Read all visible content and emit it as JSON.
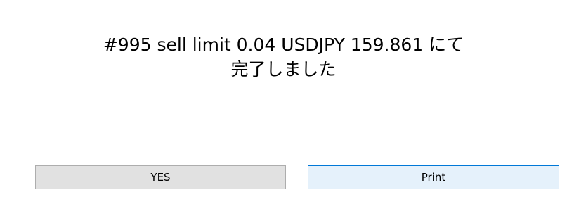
{
  "dialog": {
    "message_line1": "#995 sell limit 0.04 USDJPY 159.861 にて",
    "message_line2": "完了しました"
  },
  "buttons": {
    "yes_label": "YES",
    "print_label": "Print"
  },
  "colors": {
    "background": "#ffffff",
    "yes_button_bg": "#e1e1e1",
    "yes_button_border": "#adadad",
    "print_button_bg": "#e5f1fb",
    "print_button_border": "#0078d7"
  }
}
